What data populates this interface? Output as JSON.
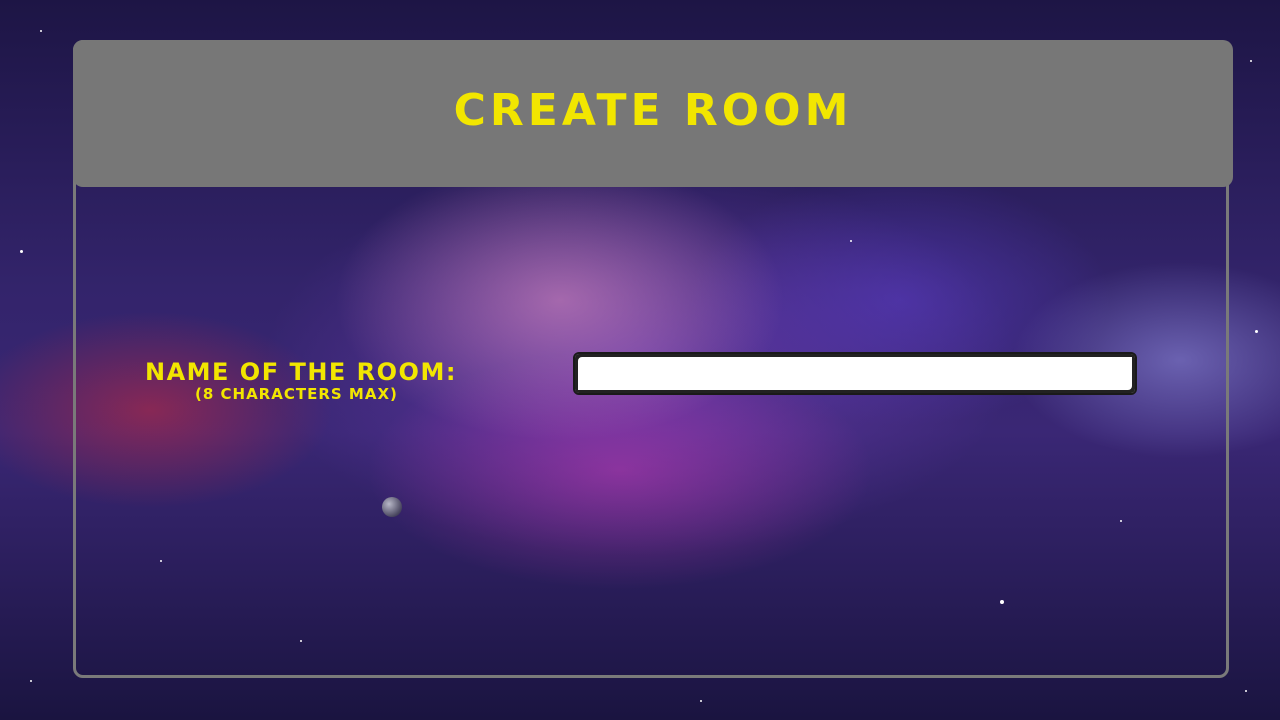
{
  "header": {
    "title": "CREATE ROOM"
  },
  "form": {
    "room_name_label": "NAME OF THE ROOM:",
    "room_name_hint": "(8 CHARACTERS MAX)",
    "room_name_value": "",
    "room_name_placeholder": ""
  },
  "colors": {
    "accent_text": "#f2e600",
    "header_bg": "#777777",
    "panel_border": "#7a7a7a",
    "input_bg": "#ffffff"
  }
}
